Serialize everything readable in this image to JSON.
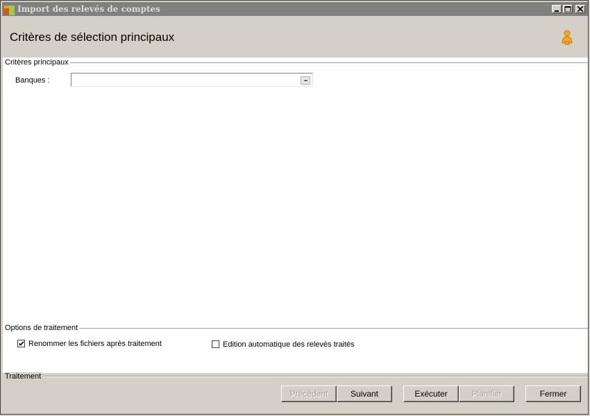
{
  "window": {
    "title": "Import des relevés de comptes",
    "controls": [
      "minimize",
      "maximize",
      "close"
    ]
  },
  "header": {
    "title": "Critères de sélection principaux",
    "icon": "user-icon"
  },
  "main_criteria": {
    "group_label": "Critères principaux",
    "banks_label": "Banques :",
    "banks_value": "",
    "browse_label": "..."
  },
  "processing_options": {
    "group_label": "Options de traitement",
    "rename_files": {
      "label": "Renommer les fichiers après traitement",
      "checked": true
    },
    "auto_edit": {
      "label": "Edition automatique des relevés traités",
      "checked": false
    }
  },
  "processing": {
    "group_label": "Traitement",
    "buttons": {
      "previous": "Précédent",
      "next": "Suivant",
      "execute": "Exécuter",
      "schedule": "Planifier",
      "close": "Fermer"
    }
  }
}
